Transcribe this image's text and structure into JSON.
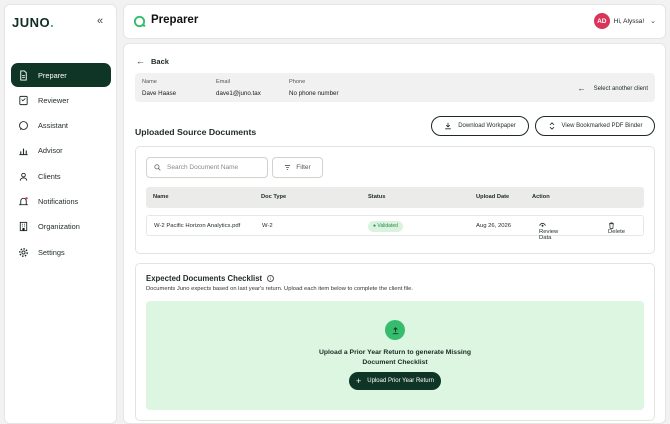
{
  "sidebar": {
    "logo_text": "JUNO",
    "logo_dot": ".",
    "collapse_glyph": "«",
    "items": [
      {
        "label": "Preparer",
        "icon": "document-icon",
        "active": true
      },
      {
        "label": "Reviewer",
        "icon": "review-icon",
        "active": false
      },
      {
        "label": "Assistant",
        "icon": "chat-icon",
        "active": false
      },
      {
        "label": "Advisor",
        "icon": "chart-icon",
        "active": false
      },
      {
        "label": "Clients",
        "icon": "clients-icon",
        "active": false
      },
      {
        "label": "Notifications",
        "icon": "bell-icon",
        "active": false
      },
      {
        "label": "Organization",
        "icon": "building-icon",
        "active": false
      },
      {
        "label": "Settings",
        "icon": "gear-icon",
        "active": false
      }
    ]
  },
  "header": {
    "title": "Preparer",
    "user_initials": "AD",
    "greeting": "Hi, Alyssa!",
    "avatar_color": "#d9345a"
  },
  "client": {
    "back_label": "Back",
    "name_label": "Name",
    "name_value": "Dave Haase",
    "email_label": "Email",
    "email_value": "dave1@juno.tax",
    "phone_label": "Phone",
    "phone_value": "No phone number",
    "select_label": "Select another client"
  },
  "documents": {
    "section_title": "Uploaded Source Documents",
    "download_label": "Download Workpaper",
    "bookmarked_label": "View Bookmarked PDF Binder",
    "search_placeholder": "Search Document Name",
    "filter_label": "Filter",
    "columns": [
      "Name",
      "Doc Type",
      "Status",
      "Upload Date",
      "Action"
    ],
    "rows": [
      {
        "name": "W-2 Pacific Horizon Analytics.pdf",
        "doc_type": "W-2",
        "status": "Validated",
        "upload_date": "Aug 26, 2026",
        "review_label": "Review Data",
        "delete_label": "Delete"
      }
    ]
  },
  "checklist": {
    "title": "Expected Documents Checklist",
    "description": "Documents Juno expects based on last year's return. Upload each item below to complete the client file.",
    "prompt_line1": "Upload a Prior Year Return to generate Missing",
    "prompt_line2": "Document Checklist",
    "upload_button": "Upload Prior Year Return"
  },
  "colors": {
    "primary_dark": "#0f3527",
    "accent_green": "#35bd6d",
    "drop_bg": "#dcf6e2"
  }
}
